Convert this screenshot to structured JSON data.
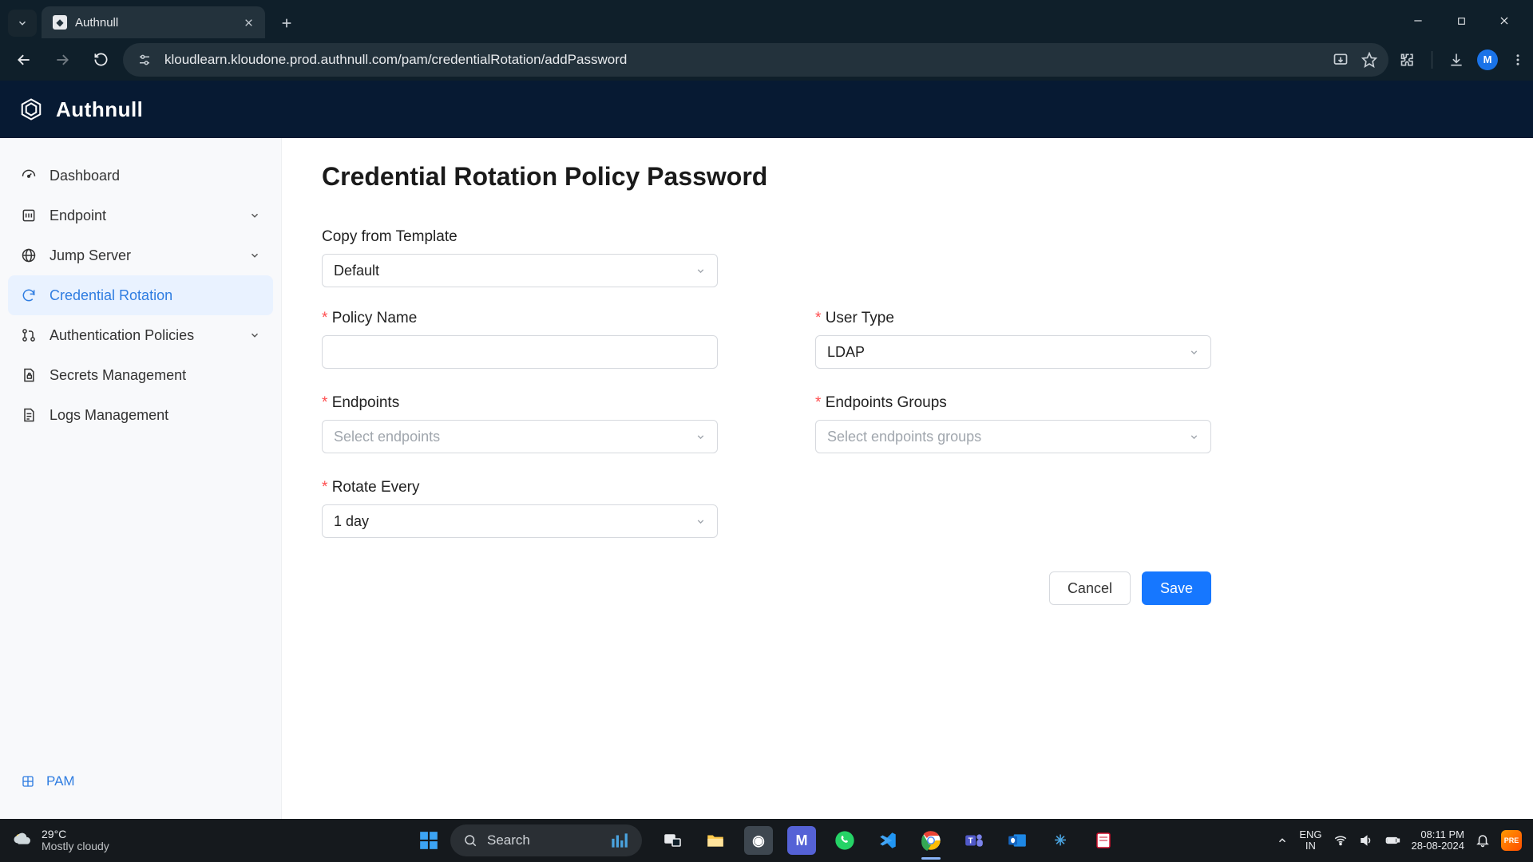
{
  "browser": {
    "tab_title": "Authnull",
    "url": "kloudlearn.kloudone.prod.authnull.com/pam/credentialRotation/addPassword",
    "avatar_letter": "M"
  },
  "app": {
    "brand": "Authnull"
  },
  "sidebar": {
    "items": [
      {
        "label": "Dashboard",
        "expandable": false
      },
      {
        "label": "Endpoint",
        "expandable": true
      },
      {
        "label": "Jump Server",
        "expandable": true
      },
      {
        "label": "Credential Rotation",
        "expandable": false,
        "active": true
      },
      {
        "label": "Authentication Policies",
        "expandable": true
      },
      {
        "label": "Secrets Management",
        "expandable": false
      },
      {
        "label": "Logs Management",
        "expandable": false
      }
    ],
    "footer": "PAM"
  },
  "page": {
    "title": "Credential Rotation Policy Password",
    "copy_from_template_label": "Copy from Template",
    "copy_from_template_value": "Default",
    "policy_name_label": "Policy Name",
    "policy_name_value": "",
    "user_type_label": "User Type",
    "user_type_value": "LDAP",
    "endpoints_label": "Endpoints",
    "endpoints_placeholder": "Select endpoints",
    "endpoints_groups_label": "Endpoints Groups",
    "endpoints_groups_placeholder": "Select endpoints groups",
    "rotate_every_label": "Rotate Every",
    "rotate_every_value": "1 day",
    "cancel": "Cancel",
    "save": "Save"
  },
  "taskbar": {
    "temp": "29°C",
    "cond": "Mostly cloudy",
    "search_placeholder": "Search",
    "lang_top": "ENG",
    "lang_bot": "IN",
    "time": "08:11 PM",
    "date": "28-08-2024",
    "copilot": "PRE"
  }
}
